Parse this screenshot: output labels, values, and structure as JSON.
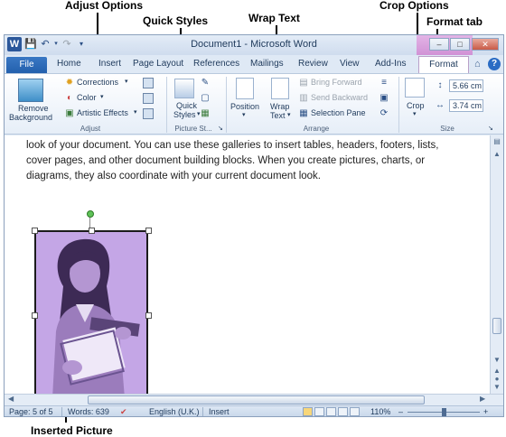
{
  "annotations": {
    "adjust_options": "Adjust Options",
    "quick_styles": "Quick Styles",
    "wrap_text": "Wrap Text",
    "crop_options": "Crop Options",
    "format_tab": "Format    tab",
    "inserted_picture": "Inserted Picture"
  },
  "window": {
    "title": "Document1 - Microsoft Word",
    "app_icon_letter": "W",
    "qat": [
      "save-icon",
      "undo-icon",
      "redo-icon",
      "customize-icon"
    ]
  },
  "tabs": {
    "file": "File",
    "items": [
      "Home",
      "Insert",
      "Page Layout",
      "References",
      "Mailings",
      "Review",
      "View",
      "Add-Ins"
    ],
    "format": "Format",
    "help": "?"
  },
  "ribbon": {
    "remove_background": [
      "Remove",
      "Background"
    ],
    "corrections": "Corrections",
    "color": "Color",
    "artistic_effects": "Artistic Effects",
    "adjust_label": "Adjust",
    "quick_styles": [
      "Quick",
      "Styles"
    ],
    "picture_styles_label": "Picture St...",
    "position": "Position",
    "wrap_text": [
      "Wrap",
      "Text"
    ],
    "bring_forward": "Bring Forward",
    "send_backward": "Send Backward",
    "selection_pane": "Selection Pane",
    "arrange_label": "Arrange",
    "crop": "Crop",
    "height": "5.66 cm",
    "width": "3.74 cm",
    "size_label": "Size"
  },
  "document": {
    "lines": [
      "look of your document. You can use these galleries to insert tables, headers, footers, lists,",
      "cover pages, and other document building blocks. When you create pictures, charts, or",
      "diagrams, they also coordinate with your current document look."
    ]
  },
  "status": {
    "page": "Page: 5 of 5",
    "words": "Words: 639",
    "language": "English (U.K.)",
    "mode": "Insert",
    "zoom": "110%",
    "zoom_minus": "–",
    "zoom_plus": "+"
  },
  "colors": {
    "picture_tint": "#c4a6e6",
    "picture_tools_tab": "#cf8fd4",
    "file_tab": "#2360ad"
  }
}
